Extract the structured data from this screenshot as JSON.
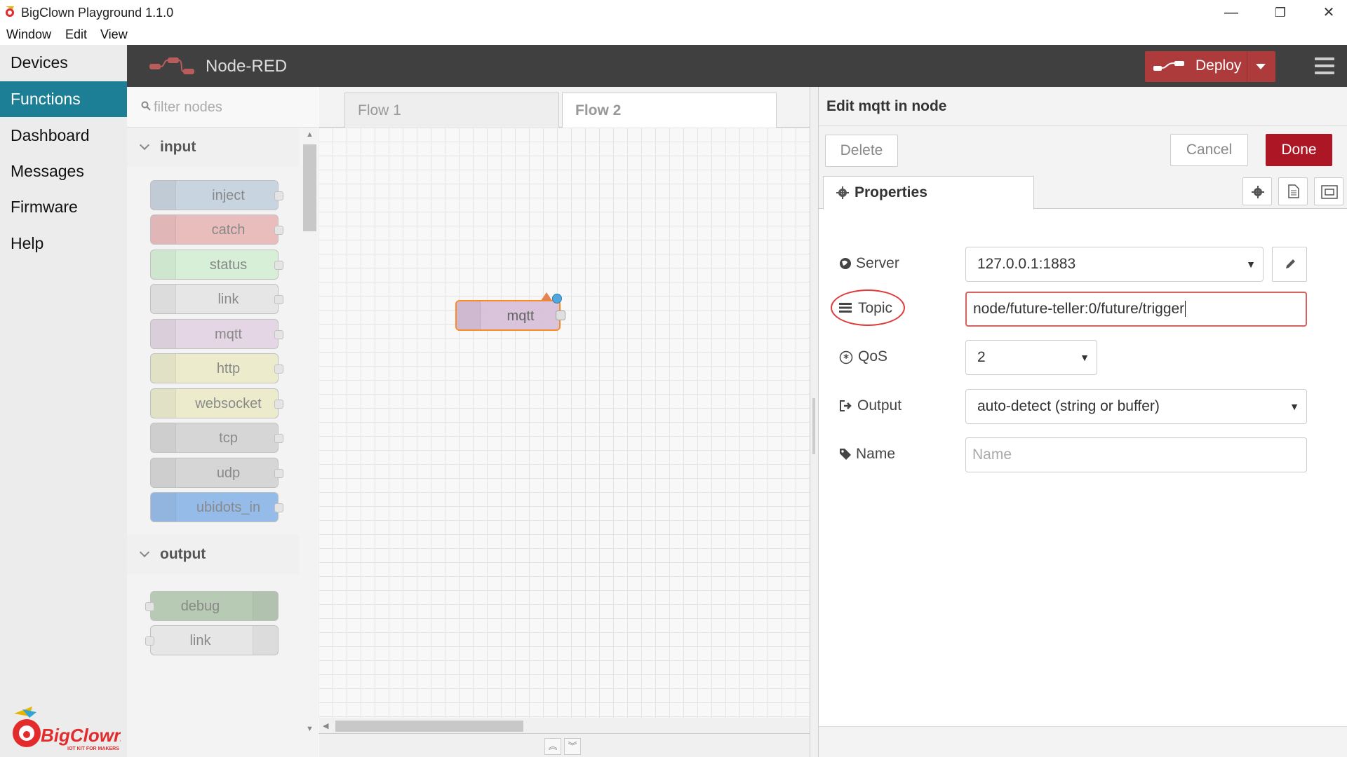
{
  "window": {
    "title": "BigClown Playground 1.1.0",
    "controls": {
      "minimize": "—",
      "restore": "❐",
      "close": "✕"
    }
  },
  "menubar": [
    "Window",
    "Edit",
    "View"
  ],
  "app_nav": {
    "items": [
      "Devices",
      "Functions",
      "Dashboard",
      "Messages",
      "Firmware",
      "Help"
    ],
    "active": "Functions"
  },
  "brand": {
    "name": "BigClown",
    "tagline": "IOT KIT FOR MAKERS"
  },
  "header": {
    "title": "Node-RED",
    "deploy_label": "Deploy"
  },
  "palette": {
    "filter_placeholder": "filter nodes",
    "categories": [
      {
        "name": "input",
        "nodes": [
          {
            "label": "inject",
            "color": "#a6bbcf"
          },
          {
            "label": "catch",
            "color": "#e49191"
          },
          {
            "label": "status",
            "color": "#c0edc0"
          },
          {
            "label": "link",
            "color": "#dddddd"
          },
          {
            "label": "mqtt",
            "color": "#d8bfd8"
          },
          {
            "label": "http",
            "color": "#e7e7ae"
          },
          {
            "label": "websocket",
            "color": "#e7e7ae"
          },
          {
            "label": "tcp",
            "color": "#c0c0c0"
          },
          {
            "label": "udp",
            "color": "#c0c0c0"
          },
          {
            "label": "ubidots_in",
            "color": "#4a90e2"
          }
        ]
      },
      {
        "name": "output",
        "nodes": [
          {
            "label": "debug",
            "color": "#87a980"
          },
          {
            "label": "link",
            "color": "#dddddd"
          }
        ]
      }
    ]
  },
  "workspace": {
    "tabs": [
      "Flow 1",
      "Flow 2"
    ],
    "active_tab": "Flow 2",
    "nodes": [
      {
        "label": "mqtt",
        "color": "#d8bfd8",
        "selected": true,
        "has_warning": true,
        "changed": true
      }
    ]
  },
  "tray": {
    "title": "Edit mqtt in node",
    "delete_label": "Delete",
    "cancel_label": "Cancel",
    "done_label": "Done",
    "tab_label": "Properties",
    "fields": {
      "server": {
        "label": "Server",
        "value": "127.0.0.1:1883"
      },
      "topic": {
        "label": "Topic",
        "value": "node/future-teller:0/future/trigger"
      },
      "qos": {
        "label": "QoS",
        "value": "2"
      },
      "output": {
        "label": "Output",
        "value": "auto-detect (string or buffer)"
      },
      "name": {
        "label": "Name",
        "value": "",
        "placeholder": "Name"
      }
    }
  },
  "colors": {
    "accent_nav": "#1d7f96",
    "deploy": "#ad3b3b",
    "done": "#ad1625",
    "header": "#404040",
    "annotation": "#e03a3a"
  }
}
